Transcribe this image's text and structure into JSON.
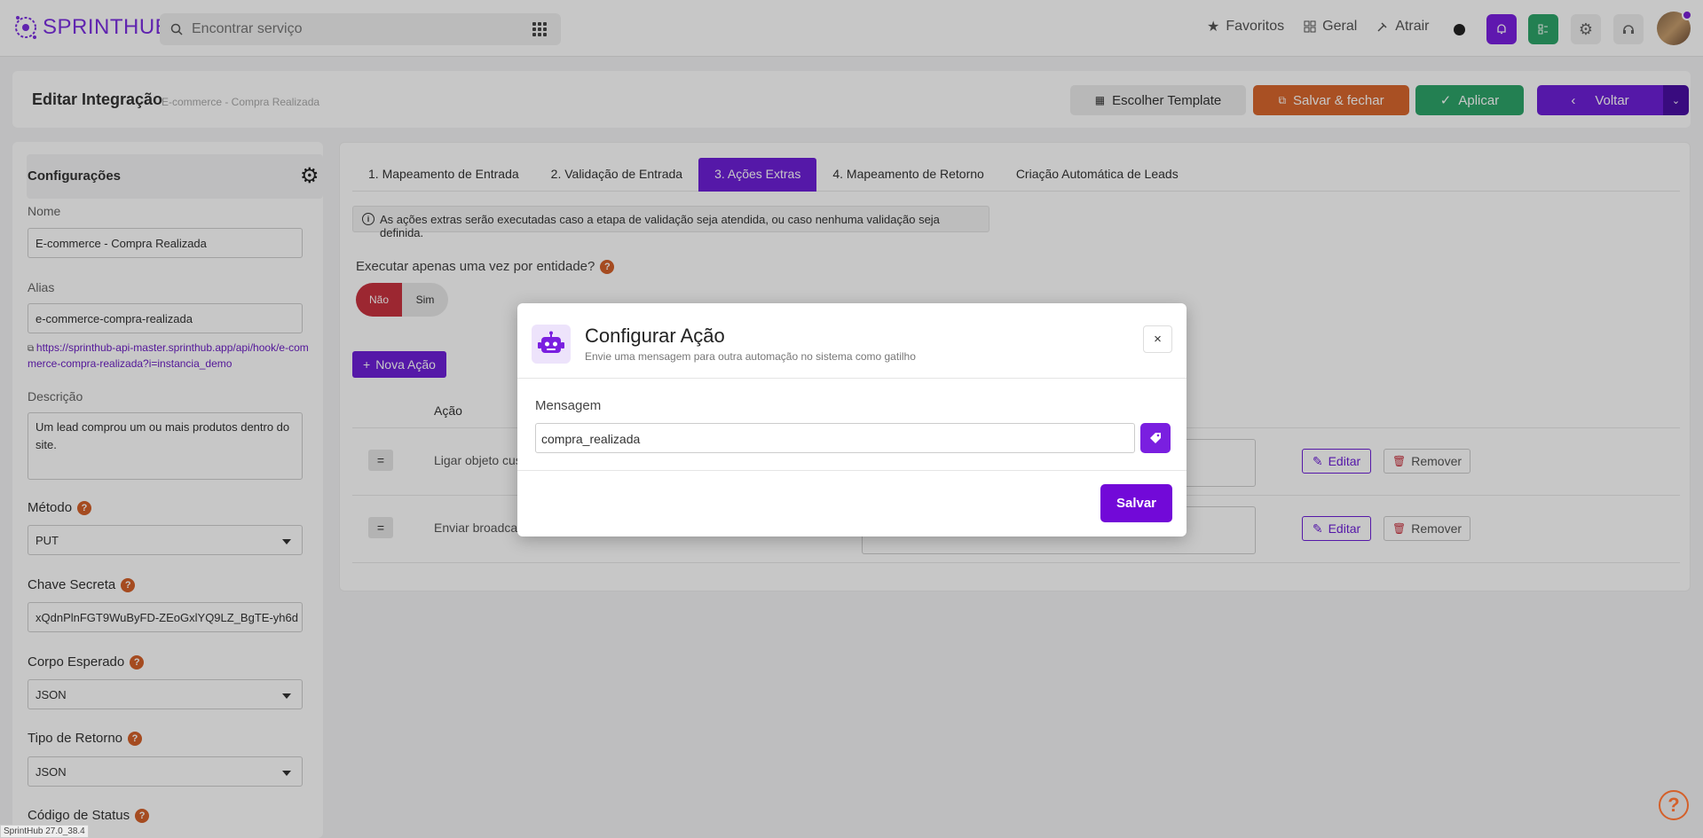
{
  "app": {
    "brand": "SPRINTHUB",
    "version": "SprintHub 27.0_38.4"
  },
  "topnav": {
    "search_placeholder": "Encontrar serviço",
    "links": [
      {
        "label": "Favoritos",
        "icon": "star-icon"
      },
      {
        "label": "Geral",
        "icon": "grid-icon"
      },
      {
        "label": "Atrair",
        "icon": "magnet-icon"
      }
    ]
  },
  "header": {
    "title": "Editar Integração",
    "subtitle": "E-commerce - Compra Realizada",
    "buttons": {
      "template": "Escolher Template",
      "save_close": "Salvar & fechar",
      "apply": "Aplicar",
      "back": "Voltar"
    }
  },
  "sidebar": {
    "heading": "Configurações",
    "name_label": "Nome",
    "name_value": "E-commerce - Compra Realizada",
    "alias_label": "Alias",
    "alias_value": "e-commerce-compra-realizada",
    "webhook_url": "https://sprinthub-api-master.sprinthub.app/api/hook/e-commerce-compra-realizada?i=instancia_demo",
    "description_label": "Descrição",
    "description_value": "Um lead comprou um ou mais produtos dentro do site.",
    "method_label": "Método",
    "method_value": "PUT",
    "secret_label": "Chave Secreta",
    "secret_value": "xQdnPlnFGT9WuByFD-ZEoGxlYQ9LZ_BgTE-yh6d",
    "body_label": "Corpo Esperado",
    "body_value": "JSON",
    "return_label": "Tipo de Retorno",
    "return_value": "JSON",
    "status_label": "Código de Status"
  },
  "main": {
    "tabs": [
      {
        "label": "1. Mapeamento de Entrada",
        "active": false
      },
      {
        "label": "2. Validação de Entrada",
        "active": false
      },
      {
        "label": "3. Ações Extras",
        "active": true
      },
      {
        "label": "4. Mapeamento de Retorno",
        "active": false
      },
      {
        "label": "Criação Automática de Leads",
        "active": false
      }
    ],
    "info_text": "As ações extras serão executadas caso a etapa de validação seja atendida, ou caso nenhuma validação seja definida.",
    "once_question": "Executar apenas uma vez por entidade?",
    "toggle": {
      "no": "Não",
      "yes": "Sim",
      "selected": "Não"
    },
    "new_action": "Nova Ação",
    "table_header": "Ação",
    "rows": [
      {
        "name": "Ligar objeto cus",
        "edit": "Editar",
        "remove": "Remover"
      },
      {
        "name": "Enviar broadcast",
        "edit": "Editar",
        "remove": "Remover"
      }
    ]
  },
  "modal": {
    "title": "Configurar Ação",
    "subtitle": "Envie uma mensagem para outra automação no sistema como gatilho",
    "field_label": "Mensagem",
    "field_value": "compra_realizada",
    "save": "Salvar"
  },
  "colors": {
    "primary": "#6d1fd8",
    "orange": "#d9672d",
    "green": "#2ea46a",
    "danger": "#c8323f"
  }
}
